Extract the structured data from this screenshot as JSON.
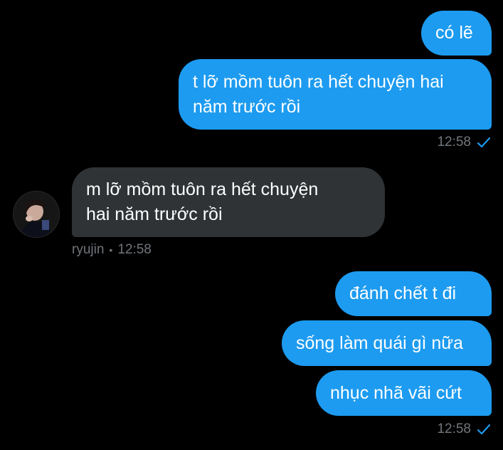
{
  "messages": [
    {
      "text": "có lẽ"
    },
    {
      "text": "t lỡ mồm tuôn ra hết chuyện hai\nnăm trước rồi"
    },
    {
      "text": "m lỡ mồm tuôn ra hết chuyện\nhai năm trước rồi"
    },
    {
      "text": "đánh chết t đi"
    },
    {
      "text": "sống làm quái gì nữa"
    },
    {
      "text": "nhục nhã vãi cứt"
    }
  ],
  "sent_time_1": "12:58",
  "received_meta": {
    "username": "ryujin",
    "separator": "•",
    "time": "12:58"
  },
  "sent_time_2": "12:58",
  "colors": {
    "sent_bubble": "#1d9bf0",
    "received_bubble": "#2f3336",
    "meta_text": "#71767b",
    "read_check": "#1d9bf0"
  },
  "icons": {
    "read_receipt": "checkmark-icon",
    "avatar": "avatar"
  }
}
